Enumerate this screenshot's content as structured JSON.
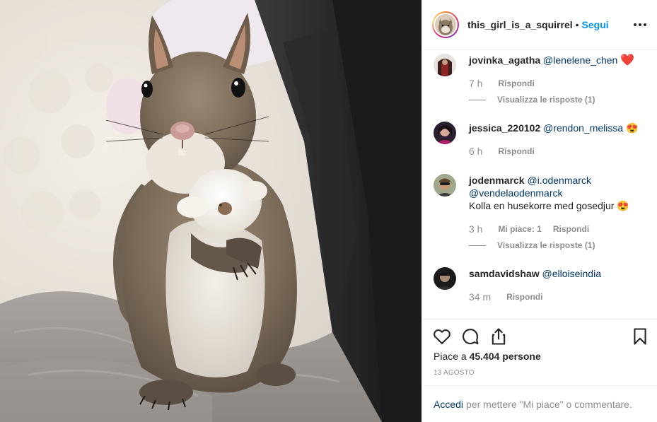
{
  "header": {
    "username": "this_girl_is_a_squirrel",
    "separator": "•",
    "follow_label": "Segui",
    "more_icon": "more-horizontal-icon"
  },
  "comments": [
    {
      "username": "jovinka_agatha",
      "mention": "@lenelene_chen",
      "text": "",
      "emoji": "❤️",
      "time": "7 h",
      "likes": "",
      "reply_label": "Rispondi",
      "view_replies": "Visualizza le risposte (1)"
    },
    {
      "username": "jessica_220102",
      "mention": "@rendon_melissa",
      "text": "",
      "emoji": "😍",
      "time": "6 h",
      "likes": "",
      "reply_label": "Rispondi",
      "view_replies": ""
    },
    {
      "username": "jodenmarck",
      "mention": "@i.odenmarck",
      "mention2": "@vendelaodenmarck",
      "text": "Kolla en husekorre med gosedjur",
      "emoji": "😍",
      "time": "3 h",
      "likes": "Mi piace: 1",
      "reply_label": "Rispondi",
      "view_replies": "Visualizza le risposte (1)"
    },
    {
      "username": "samdavidshaw",
      "mention": "@elloiseindia",
      "text": "",
      "emoji": "",
      "time": "34 m",
      "likes": "",
      "reply_label": "Rispondi",
      "view_replies": ""
    }
  ],
  "actions": {
    "like_icon": "heart-outline-icon",
    "comment_icon": "comment-bubble-icon",
    "share_icon": "share-upload-icon",
    "save_icon": "bookmark-icon",
    "likes_prefix": "Piace a",
    "likes_count": "45.404",
    "likes_suffix": "persone",
    "date": "13 AGOSTO"
  },
  "login_bar": {
    "link": "Accedi",
    "rest": "per mettere \"Mi piace\" o commentare."
  },
  "colors": {
    "link_blue": "#0095f6",
    "mention_blue": "#00376b",
    "muted": "#8e8e8e",
    "border": "#efefef",
    "heart_red": "#ed4956"
  }
}
